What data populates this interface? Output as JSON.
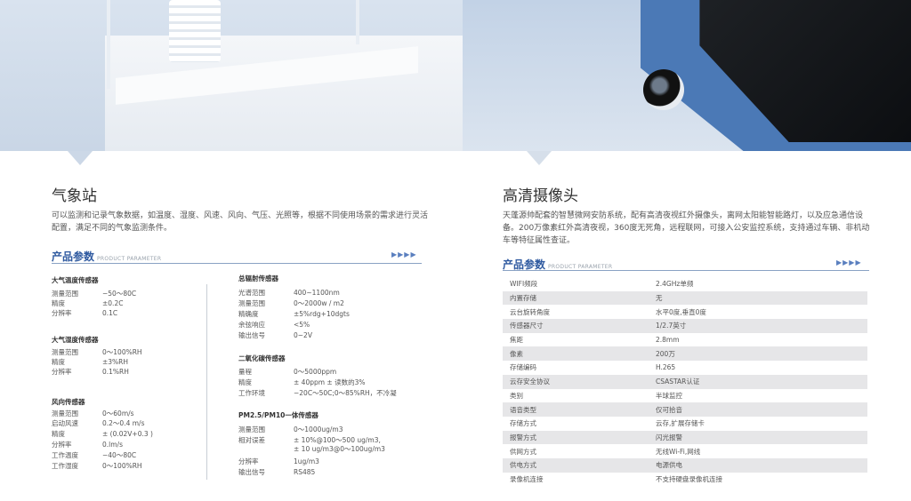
{
  "left": {
    "title": "气象站",
    "desc_line1": "可以监测和记录气象数据，如温度、湿度、风速、风向、气压、光照等，根据不同使用场景的需求进行灵活",
    "desc_line2": "配置，满足不同的气象监测条件。",
    "param_title": "产品参数",
    "param_sub": "PRODUCT PARAMETER",
    "arrows": "▶▶▶▶",
    "groups": [
      {
        "title": "大气温度传感器",
        "rows": [
          [
            "测量范围",
            "−50～80C"
          ],
          [
            "精度",
            "±0.2C"
          ],
          [
            "分辨率",
            "0.1C"
          ]
        ]
      },
      {
        "title": "大气湿度传感器",
        "rows": [
          [
            "测量范围",
            "0～100%RH"
          ],
          [
            "精度",
            "±3%RH"
          ],
          [
            "分辨率",
            "0.1%RH"
          ]
        ]
      },
      {
        "title": "风向传感器",
        "rows": [
          [
            "测量范围",
            "0～60m/s"
          ],
          [
            "启动风速",
            "0.2～0.4 m/s"
          ],
          [
            "精度",
            "± (0.02V+0.3 )"
          ],
          [
            "分辨率",
            "0.lm/s"
          ],
          [
            "工作温度",
            "−40～80C"
          ],
          [
            "工作湿度",
            "0～100%RH"
          ]
        ]
      },
      {
        "title": "总辐射传感器",
        "rows": [
          [
            "光谱范围",
            "400~1100nm"
          ],
          [
            "测量范围",
            "0～2000w / m2"
          ],
          [
            "精确度",
            "±5%rdg+10dgts"
          ],
          [
            "余弦响应",
            "<5%"
          ],
          [
            "输出信号",
            "0~2V"
          ]
        ]
      },
      {
        "title": "二氧化碳传感器",
        "rows": [
          [
            "量程",
            "0～5000ppm"
          ],
          [
            "精度",
            "± 40ppm ± 读数的3%"
          ],
          [
            "工作环境",
            "−20C～50C;0～85%RH，不冷凝"
          ]
        ]
      },
      {
        "title": "PM2.5/PM10一体传感器",
        "rows": [
          [
            "测量范围",
            "0～1000ug/m3"
          ],
          [
            "相对误差",
            "± 10%@100～500 ug/m3,"
          ],
          [
            "",
            "± 10 ug/m3@0～100ug/m3"
          ],
          [
            "分辨率",
            "1ug/m3"
          ],
          [
            "输出信号",
            "RS485"
          ]
        ]
      }
    ]
  },
  "right": {
    "title": "高清摄像头",
    "desc_line1": "天蓬源帅配套的智慧微网安防系统，配有高清夜视红外摄像头，离网太阳能智能路灯，以及应急通信设",
    "desc_line2": "备。200万像素红外高清夜视，360度无死角，远程联网，可接入公安监控系统，支持通过车辆、非机动",
    "desc_line3": "车等特征属性查证。",
    "param_title": "产品参数",
    "param_sub": "PRODUCT PARAMETER",
    "arrows": "▶▶▶▶",
    "table": [
      [
        "WIFI频段",
        "2.4GHz单频"
      ],
      [
        "内置存储",
        "无"
      ],
      [
        "云台旋转角度",
        "水平0度,垂直0度"
      ],
      [
        "传感器尺寸",
        "1/2.7英寸"
      ],
      [
        "焦距",
        "2.8mm"
      ],
      [
        "像素",
        "200万"
      ],
      [
        "存储编码",
        "H.265"
      ],
      [
        "云存安全协议",
        "CSASTAR认证"
      ],
      [
        "类别",
        "半球监控"
      ],
      [
        "语音类型",
        "仅可拾音"
      ],
      [
        "存储方式",
        "云存,扩展存储卡"
      ],
      [
        "报警方式",
        "闪光报警"
      ],
      [
        "供网方式",
        "无线Wi-Fi,网线"
      ],
      [
        "供电方式",
        "电源供电"
      ],
      [
        "录像机连接",
        "不支持硬盘录像机连接"
      ]
    ]
  },
  "colors": {
    "accent": "#2f5aa0",
    "table_alt": "#e6e6e8"
  }
}
